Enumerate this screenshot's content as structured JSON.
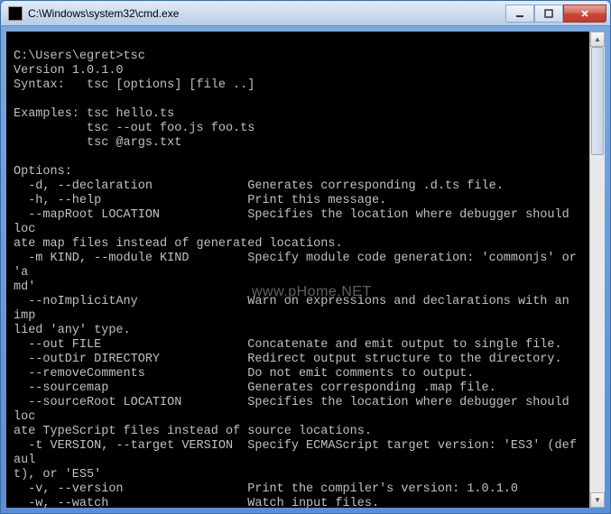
{
  "window": {
    "title": "C:\\Windows\\system32\\cmd.exe"
  },
  "terminal": {
    "content": "\nC:\\Users\\egret>tsc\nVersion 1.0.1.0\nSyntax:   tsc [options] [file ..]\n\nExamples: tsc hello.ts\n          tsc --out foo.js foo.ts\n          tsc @args.txt\n\nOptions:\n  -d, --declaration             Generates corresponding .d.ts file.\n  -h, --help                    Print this message.\n  --mapRoot LOCATION            Specifies the location where debugger should loc\nate map files instead of generated locations.\n  -m KIND, --module KIND        Specify module code generation: 'commonjs' or 'a\nmd'\n  --noImplicitAny               Warn on expressions and declarations with an imp\nlied 'any' type.\n  --out FILE                    Concatenate and emit output to single file.\n  --outDir DIRECTORY            Redirect output structure to the directory.\n  --removeComments              Do not emit comments to output.\n  --sourcemap                   Generates corresponding .map file.\n  --sourceRoot LOCATION         Specifies the location where debugger should loc\nate TypeScript files instead of source locations.\n  -t VERSION, --target VERSION  Specify ECMAScript target version: 'ES3' (defaul\nt), or 'ES5'\n  -v, --version                 Print the compiler's version: 1.0.1.0\n  -w, --watch                   Watch input files.\n  @<file>                       Insert command line options and files from a fil\ne.\n\nC:\\Users\\egret>"
  },
  "watermark": "www.pHome.NET"
}
